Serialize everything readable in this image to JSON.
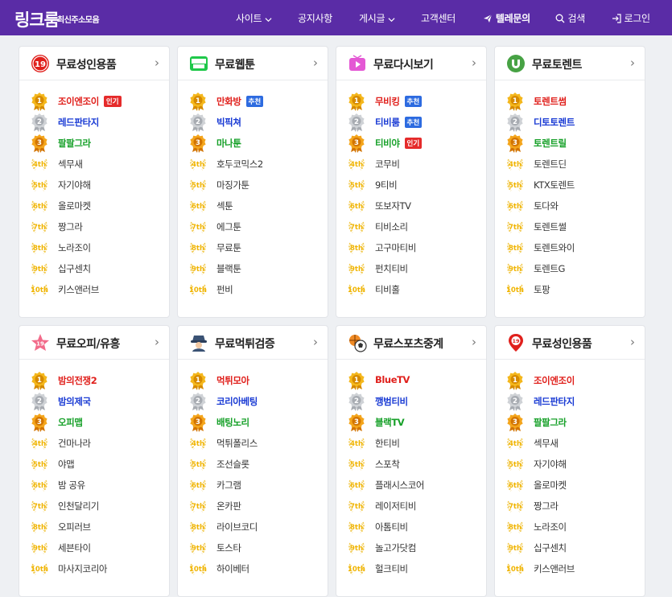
{
  "header": {
    "logo": "링크룸",
    "logo_sub": "최신주소모음",
    "nav": [
      {
        "label": "사이트",
        "icon": "chevron-down-icon"
      },
      {
        "label": "공지사항"
      },
      {
        "label": "게시글",
        "icon": "chevron-down-icon"
      },
      {
        "label": "고객센터"
      },
      {
        "label": "텔레문의",
        "icon": "telegram-icon"
      },
      {
        "label": "검색",
        "icon": "search-icon"
      },
      {
        "label": "로그인",
        "icon": "login-icon"
      }
    ],
    "brand_color": "#5a2ca6"
  },
  "colors": {
    "rank1": "#e0201c",
    "rank2": "#1a3bd4",
    "rank3": "#16a028",
    "badge_hot": "#e52b2b",
    "badge_rec": "#2d6be0"
  },
  "rank_labels": [
    "1",
    "2",
    "3",
    "4th",
    "5th",
    "6th",
    "7th",
    "8th",
    "9th",
    "10th"
  ],
  "cards": [
    {
      "title": "무료성인용품",
      "icon": "adult-19-icon",
      "arrow": "›",
      "items": [
        {
          "name": "조이엔조이",
          "badge": "인기"
        },
        {
          "name": "레드판타지"
        },
        {
          "name": "팔팔그라"
        },
        {
          "name": "섹무새"
        },
        {
          "name": "자기야해"
        },
        {
          "name": "올로마켓"
        },
        {
          "name": "짱그라"
        },
        {
          "name": "노라조이"
        },
        {
          "name": "십구센치"
        },
        {
          "name": "키스앤러브"
        }
      ]
    },
    {
      "title": "무료웹툰",
      "icon": "webtoon-icon",
      "arrow": "›",
      "items": [
        {
          "name": "만화방",
          "badge": "추천"
        },
        {
          "name": "빅픽쳐"
        },
        {
          "name": "마나툰"
        },
        {
          "name": "호두코믹스2"
        },
        {
          "name": "마징가툰"
        },
        {
          "name": "섹툰"
        },
        {
          "name": "에그툰"
        },
        {
          "name": "무료툰"
        },
        {
          "name": "블랙툰"
        },
        {
          "name": "펀비"
        }
      ]
    },
    {
      "title": "무료다시보기",
      "icon": "play-video-icon",
      "arrow": "›",
      "items": [
        {
          "name": "무비킹",
          "badge": "추천"
        },
        {
          "name": "티비룸",
          "badge": "추천"
        },
        {
          "name": "티비야",
          "badge": "인기"
        },
        {
          "name": "코무비"
        },
        {
          "name": "9티비"
        },
        {
          "name": "또보자TV"
        },
        {
          "name": "티비소리"
        },
        {
          "name": "고구마티비"
        },
        {
          "name": "펀치티비"
        },
        {
          "name": "티비홀"
        }
      ]
    },
    {
      "title": "무료토렌트",
      "icon": "utorrent-icon",
      "arrow": "›",
      "items": [
        {
          "name": "토렌트썸"
        },
        {
          "name": "디토토렌트"
        },
        {
          "name": "토렌트릴"
        },
        {
          "name": "토렌트딘"
        },
        {
          "name": "KTX토렌트"
        },
        {
          "name": "토다와"
        },
        {
          "name": "토렌트썰"
        },
        {
          "name": "토렌트와이"
        },
        {
          "name": "토렌트G"
        },
        {
          "name": "토팡"
        }
      ]
    },
    {
      "title": "무료오피/유흥",
      "icon": "star-19-icon",
      "arrow": "›",
      "items": [
        {
          "name": "밤의전쟁2"
        },
        {
          "name": "밤의제국"
        },
        {
          "name": "오피맵"
        },
        {
          "name": "건마나라"
        },
        {
          "name": "야맵"
        },
        {
          "name": "밤 공유"
        },
        {
          "name": "인천달리기"
        },
        {
          "name": "오피러브"
        },
        {
          "name": "세븐타이"
        },
        {
          "name": "마사지코리아"
        }
      ]
    },
    {
      "title": "무료먹튀검증",
      "icon": "detective-icon",
      "arrow": "›",
      "items": [
        {
          "name": "먹튀모아"
        },
        {
          "name": "코리아베팅"
        },
        {
          "name": "배팅노리"
        },
        {
          "name": "먹튀폴리스"
        },
        {
          "name": "조선슬롯"
        },
        {
          "name": "카그램"
        },
        {
          "name": "온카판"
        },
        {
          "name": "라이브코디"
        },
        {
          "name": "토스타"
        },
        {
          "name": "하이베터"
        }
      ]
    },
    {
      "title": "무료스포츠중계",
      "icon": "sports-balls-icon",
      "arrow": "›",
      "items": [
        {
          "name": "BlueTV"
        },
        {
          "name": "깽범티비"
        },
        {
          "name": "블랙TV"
        },
        {
          "name": "한티비"
        },
        {
          "name": "스포착"
        },
        {
          "name": "플래시스코어"
        },
        {
          "name": "레이저티비"
        },
        {
          "name": "아톰티비"
        },
        {
          "name": "놀고가닷컴"
        },
        {
          "name": "헐크티비"
        }
      ]
    },
    {
      "title": "무료성인용품",
      "icon": "location-19-icon",
      "arrow": "›",
      "items": [
        {
          "name": "조이엔조이"
        },
        {
          "name": "레드판타지"
        },
        {
          "name": "팔팔그라"
        },
        {
          "name": "섹무새"
        },
        {
          "name": "자기야해"
        },
        {
          "name": "올로마켓"
        },
        {
          "name": "짱그라"
        },
        {
          "name": "노라조이"
        },
        {
          "name": "십구센치"
        },
        {
          "name": "키스앤러브"
        }
      ]
    }
  ]
}
